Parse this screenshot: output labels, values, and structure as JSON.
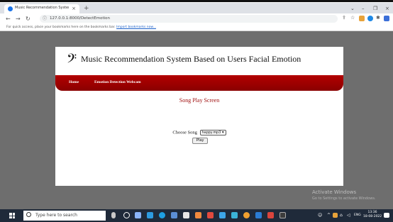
{
  "browser": {
    "tab_title": "Music Recommendation System",
    "tab_close": "×",
    "new_tab": "+",
    "controls": {
      "chevron": "⌄",
      "minimize": "–",
      "restore": "❐",
      "close": "×"
    },
    "url": "127.0.0.1:8000/DetectEmotion",
    "bookmarks_text": "For quick access, place your bookmarks here on the bookmarks bar.",
    "bookmarks_link": "Import bookmarks now..."
  },
  "page": {
    "site_title": "Music Recommendation System Based on Users Facial Emotion",
    "clef": "𝄢",
    "nav": {
      "home": "Home",
      "emotion": "Emotion Detection Webcam"
    },
    "heading": "Song Play Screen",
    "choose_label": "Choose Song",
    "selected_song": "happy.mp3",
    "play_label": "Play",
    "watermark_title": "Activate Windows",
    "watermark_sub": "Go to Settings to activate Windows."
  },
  "taskbar": {
    "search_placeholder": "Type here to search",
    "time": "13:36",
    "date": "18-08-2022",
    "lang": "ENG"
  },
  "colors": {
    "nav_red": "#a00000",
    "heading_red": "#a01010",
    "page_bg": "#6e6e6e",
    "taskbar": "#1f2a3a"
  }
}
